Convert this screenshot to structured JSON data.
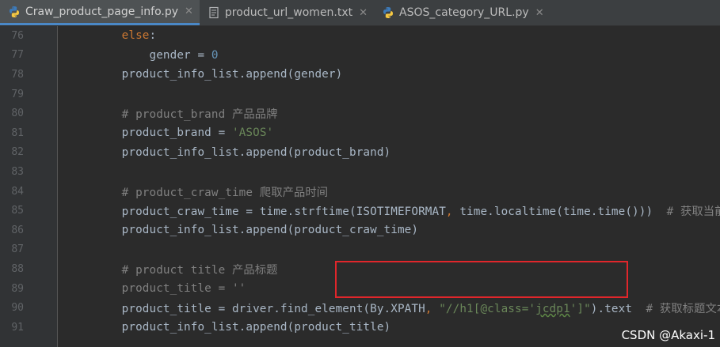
{
  "tabs": [
    {
      "label": "Craw_product_page_info.py",
      "type": "python",
      "active": true
    },
    {
      "label": "product_url_women.txt",
      "type": "text",
      "active": false
    },
    {
      "label": "ASOS_category_URL.py",
      "type": "python",
      "active": false
    }
  ],
  "lines": [
    {
      "n": "76",
      "parts": [
        {
          "t": "        "
        },
        {
          "t": "else",
          "c": "kw"
        },
        {
          "t": ":"
        }
      ]
    },
    {
      "n": "77",
      "parts": [
        {
          "t": "            gender = "
        },
        {
          "t": "0",
          "c": "num"
        }
      ]
    },
    {
      "n": "78",
      "parts": [
        {
          "t": "        product_info_list.append(gender)"
        }
      ]
    },
    {
      "n": "79",
      "parts": []
    },
    {
      "n": "80",
      "parts": [
        {
          "t": "        # product_brand 产品品牌",
          "c": "cm"
        }
      ]
    },
    {
      "n": "81",
      "parts": [
        {
          "t": "        product_brand = "
        },
        {
          "t": "'ASOS'",
          "c": "str"
        }
      ]
    },
    {
      "n": "82",
      "parts": [
        {
          "t": "        product_info_list.append(product_brand)"
        }
      ]
    },
    {
      "n": "83",
      "parts": []
    },
    {
      "n": "84",
      "parts": [
        {
          "t": "        # product_craw_time 爬取产品时间",
          "c": "cm"
        }
      ]
    },
    {
      "n": "85",
      "parts": [
        {
          "t": "        product_craw_time = time.strftime(ISOTIMEFORMAT"
        },
        {
          "t": ", ",
          "c": "kw"
        },
        {
          "t": "time.localtime(time.time()))  "
        },
        {
          "t": "# 获取当前时",
          "c": "cm"
        }
      ]
    },
    {
      "n": "86",
      "parts": [
        {
          "t": "        product_info_list.append(product_craw_time)"
        }
      ]
    },
    {
      "n": "87",
      "parts": []
    },
    {
      "n": "88",
      "parts": [
        {
          "t": "        # product title 产品标题",
          "c": "cm"
        }
      ]
    },
    {
      "n": "89",
      "parts": [
        {
          "t": "        product_title = ''",
          "c": "cm"
        }
      ]
    },
    {
      "n": "90",
      "parts": [
        {
          "t": "        product_title = driver.find_element(By.XPATH"
        },
        {
          "t": ", ",
          "c": "kw"
        },
        {
          "t": "\"//h1[@class='",
          "c": "str"
        },
        {
          "t": "jcdp1",
          "c": "str",
          "u": true
        },
        {
          "t": "']\"",
          "c": "str"
        },
        {
          "t": ").text  "
        },
        {
          "t": "# 获取标题文本",
          "c": "cm"
        }
      ]
    },
    {
      "n": "91",
      "parts": [
        {
          "t": "        product_info_list.append(product_title)"
        }
      ]
    }
  ],
  "watermark": "CSDN @Akaxi-1",
  "colors": {
    "highlight": "#e0262b",
    "background": "#2b2b2b",
    "keyword": "#cc7832",
    "string": "#6a8759",
    "comment": "#808080",
    "number": "#6897bb"
  }
}
